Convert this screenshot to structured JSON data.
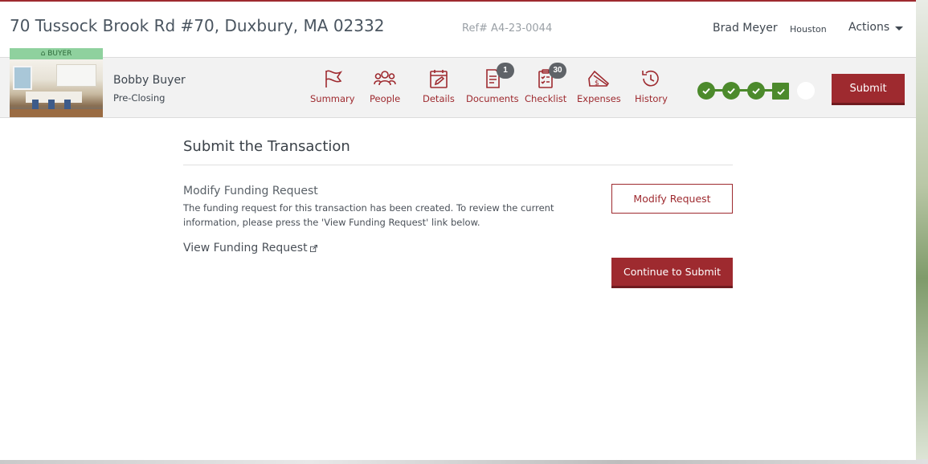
{
  "header": {
    "address": "70 Tussock Brook Rd #70, Duxbury, MA 02332",
    "ref": "Ref# A4-23-0044",
    "user_name": "Brad Meyer",
    "city": "Houston",
    "actions_label": "Actions"
  },
  "toolbar": {
    "badge": "BUYER",
    "person_name": "Bobby Buyer",
    "stage": "Pre-Closing",
    "nav": [
      {
        "label": "Summary",
        "icon": "flag-icon"
      },
      {
        "label": "People",
        "icon": "people-icon"
      },
      {
        "label": "Details",
        "icon": "calendar-edit-icon"
      },
      {
        "label": "Documents",
        "icon": "documents-icon",
        "count": "1"
      },
      {
        "label": "Checklist",
        "icon": "checklist-icon",
        "count": "30"
      },
      {
        "label": "Expenses",
        "icon": "expenses-icon"
      },
      {
        "label": "History",
        "icon": "history-icon"
      }
    ],
    "progress": {
      "completed_steps": 4,
      "total_steps": 5
    },
    "submit_label": "Submit"
  },
  "main": {
    "title": "Submit the Transaction",
    "section_title": "Modify Funding Request",
    "section_text": "The funding request for this transaction has been created. To review the current information, please press the 'View Funding Request' link below.",
    "view_link": "View Funding Request",
    "modify_button": "Modify Request",
    "continue_button": "Continue to Submit"
  },
  "colors": {
    "accent": "#9e2a2f",
    "progress_green": "#4c8a2c",
    "badge_green": "#8fd19e",
    "count_badge": "#5f6368"
  }
}
